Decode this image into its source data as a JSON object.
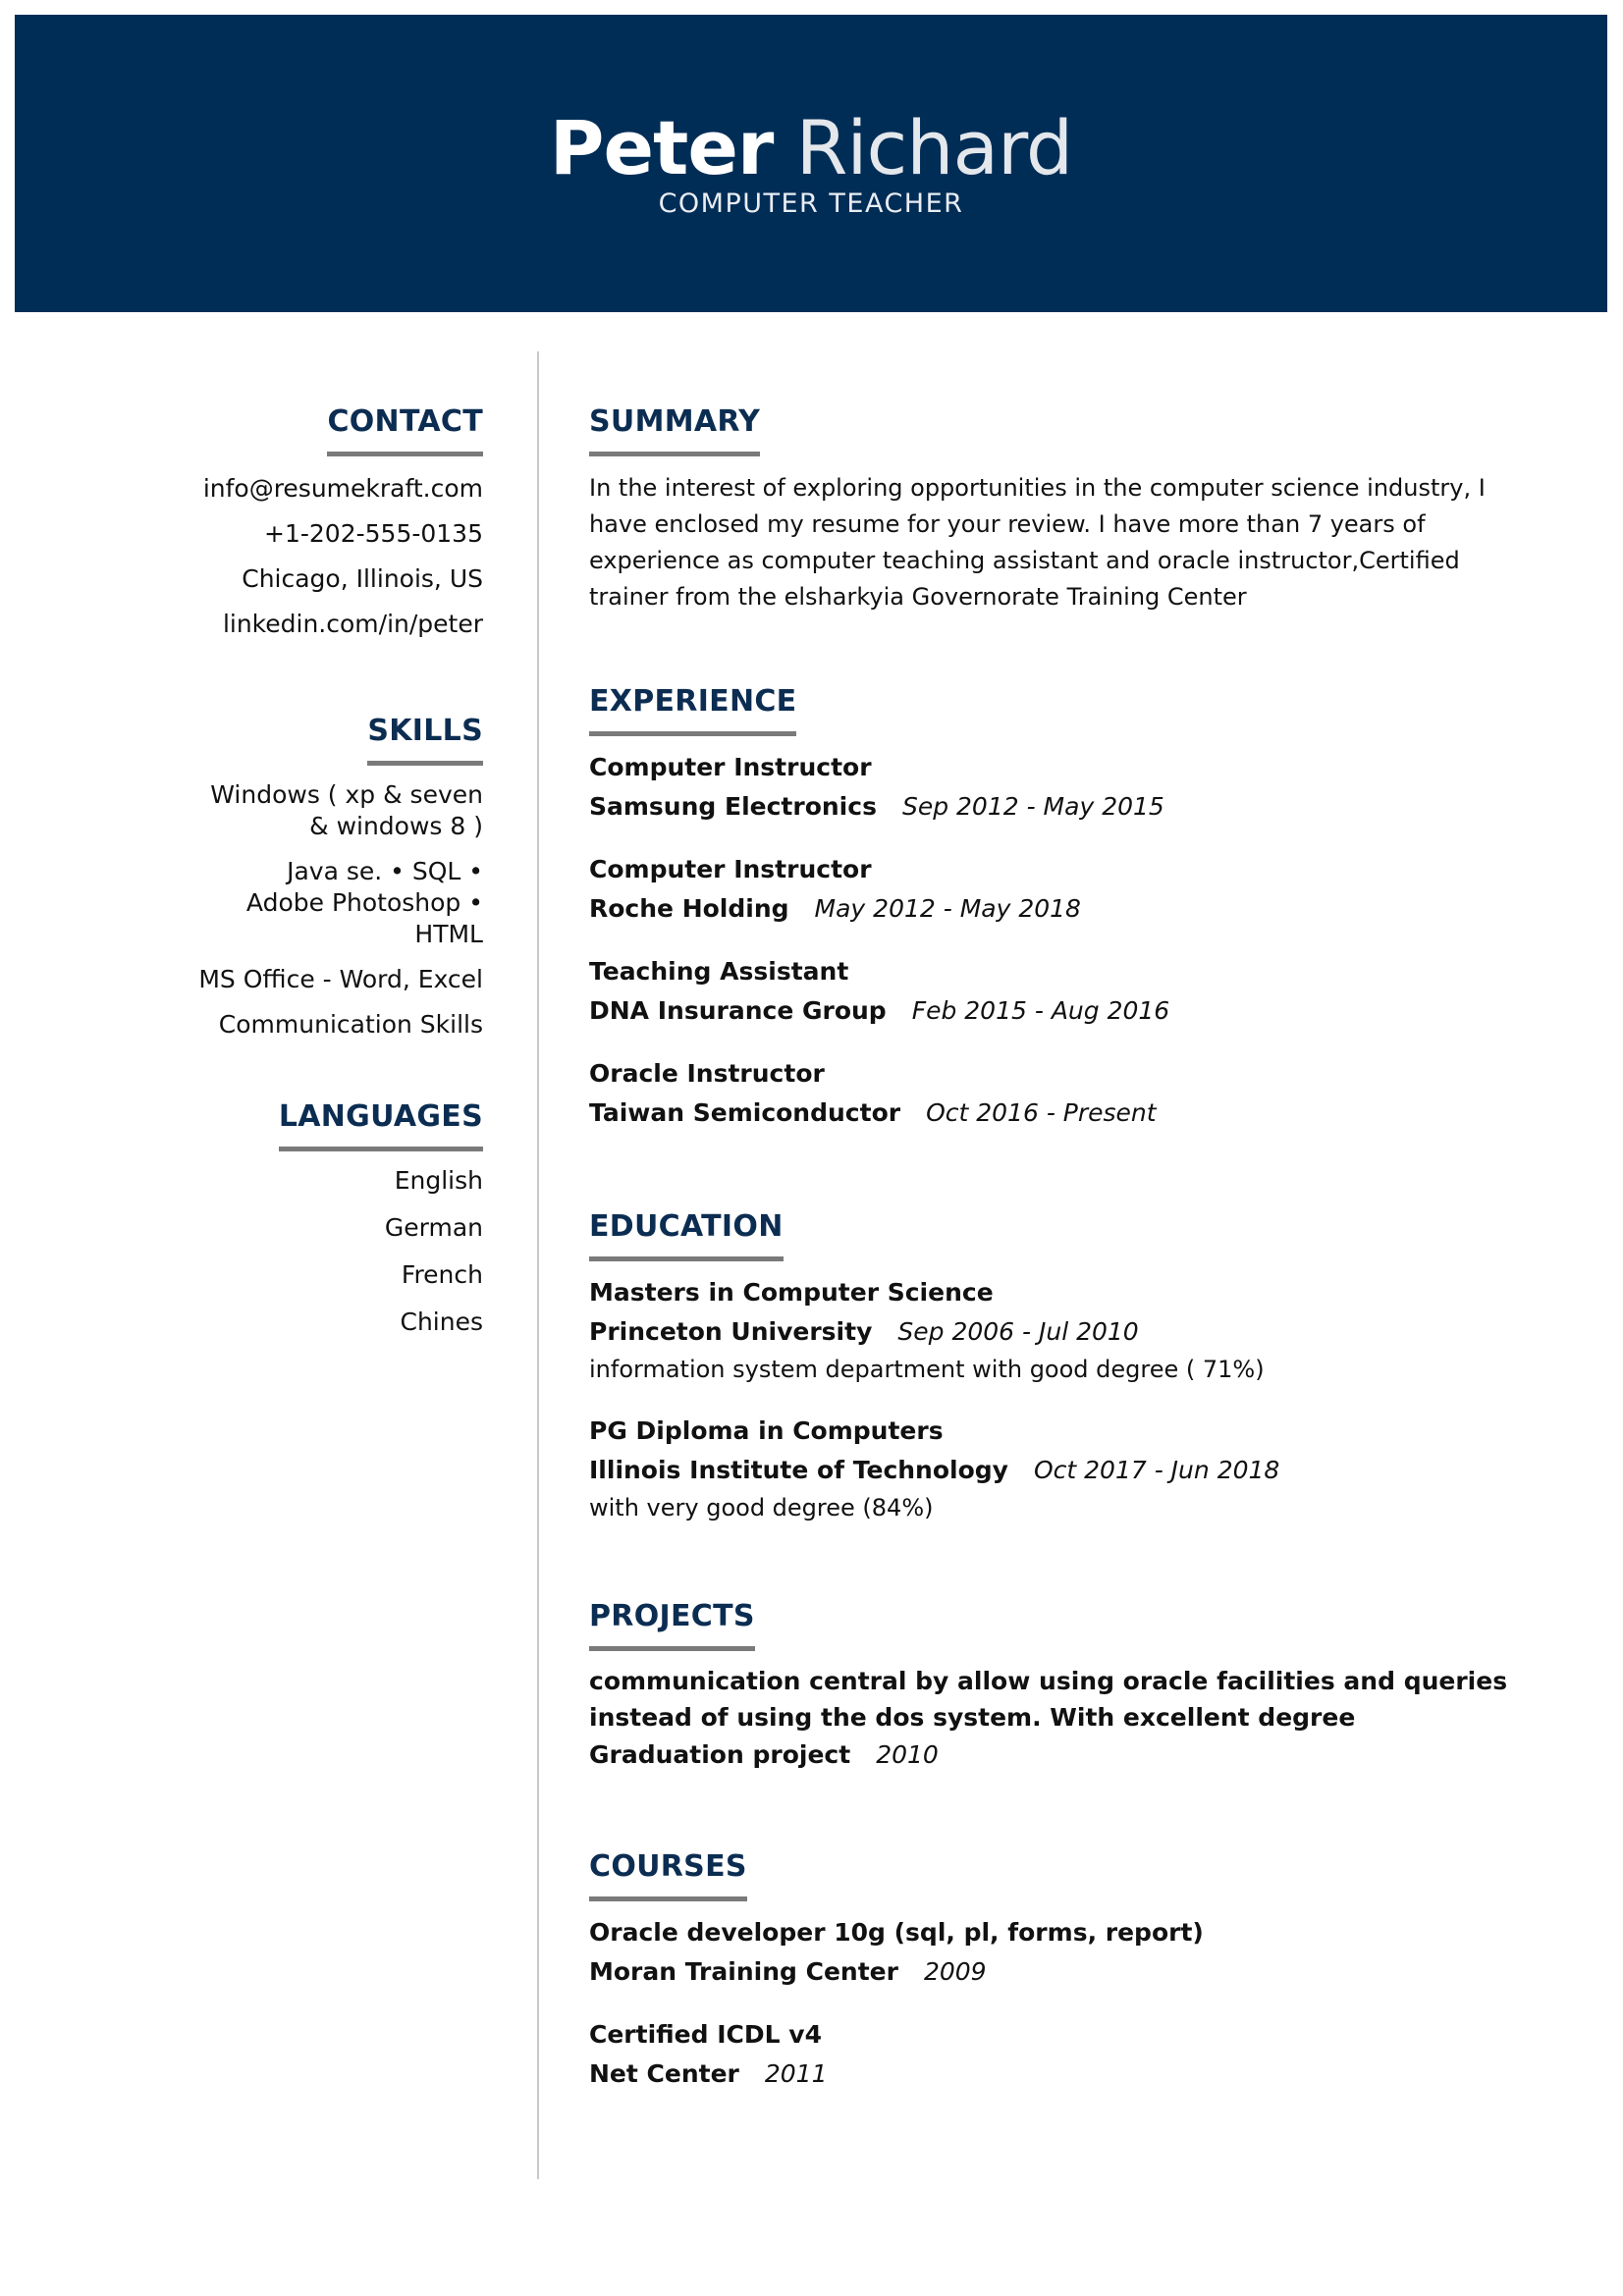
{
  "header": {
    "first_name": "Peter",
    "last_name": "Richard",
    "title": "COMPUTER TEACHER"
  },
  "colors": {
    "header_bg": "#002d56",
    "heading": "#0c2d52",
    "rule": "#7a7a7a",
    "divider": "#c9c9c9"
  },
  "contact": {
    "heading": "CONTACT",
    "email": "info@resumekraft.com",
    "phone": "+1-202-555-0135",
    "location": "Chicago, Illinois, US",
    "linkedin": "linkedin.com/in/peter"
  },
  "skills": {
    "heading": "SKILLS",
    "items": [
      "Windows ( xp & seven & windows 8 )",
      "Java se. • SQL • Adobe Photoshop • HTML",
      "MS Office - Word, Excel",
      "Communication Skills"
    ]
  },
  "languages": {
    "heading": "LANGUAGES",
    "items": [
      "English",
      "German",
      "French",
      "Chines"
    ]
  },
  "summary": {
    "heading": "SUMMARY",
    "text": "In the interest of exploring opportunities in the computer science industry, I have enclosed my resume for your review. I have more than 7 years of experience as computer teaching assistant and oracle instructor,Certified trainer from the elsharkyia Governorate Training Center"
  },
  "experience": {
    "heading": "EXPERIENCE",
    "entries": [
      {
        "role": "Computer Instructor",
        "company": "Samsung Electronics",
        "dates": "Sep 2012 - May 2015"
      },
      {
        "role": "Computer Instructor",
        "company": "Roche Holding",
        "dates": "May 2012 - May 2018"
      },
      {
        "role": "Teaching Assistant",
        "company": "DNA Insurance Group",
        "dates": "Feb 2015 - Aug 2016"
      },
      {
        "role": "Oracle Instructor",
        "company": "Taiwan Semiconductor",
        "dates": "Oct 2016 - Present"
      }
    ]
  },
  "education": {
    "heading": "EDUCATION",
    "entries": [
      {
        "degree": "Masters in Computer Science",
        "school": "Princeton University",
        "dates": "Sep 2006 - Jul 2010",
        "note": "information system department with good degree ( 71%)"
      },
      {
        "degree": "PG Diploma in Computers",
        "school": "Illinois Institute of Technology",
        "dates": "Oct 2017 - Jun 2018",
        "note": "with very good degree (84%)"
      }
    ]
  },
  "projects": {
    "heading": "PROJECTS",
    "entries": [
      {
        "description": "communication central by allow using oracle facilities and queries instead of using the dos system. With excellent degree",
        "label": "Graduation project",
        "year": "2010"
      }
    ]
  },
  "courses": {
    "heading": "COURSES",
    "entries": [
      {
        "name": "Oracle developer 10g (sql, pl, forms, report)",
        "provider": "Moran Training Center",
        "year": "2009"
      },
      {
        "name": "Certified ICDL v4",
        "provider": "Net Center",
        "year": "2011"
      }
    ]
  }
}
